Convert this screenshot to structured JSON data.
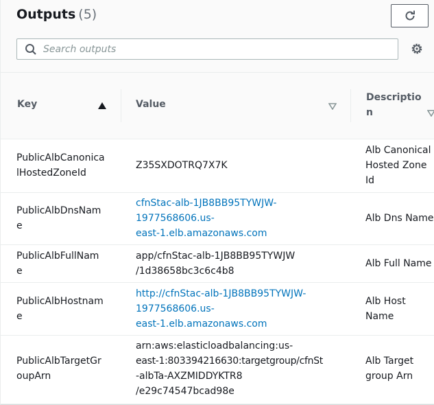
{
  "header": {
    "title": "Outputs",
    "count": "(5)",
    "refresh_icon": "refresh-icon",
    "settings_icon": "gear-icon"
  },
  "search": {
    "placeholder": "Search outputs",
    "icon": "search-icon"
  },
  "table": {
    "columns": {
      "key": "Key",
      "value": "Value",
      "description_line1": "Descriptio",
      "description_line2": "n"
    },
    "sort": {
      "column": "Key",
      "direction": "ascending"
    },
    "rows": [
      {
        "key": [
          "PublicAlbCanonica",
          "lHostedZoneId"
        ],
        "value": [
          "Z35SXDOTRQ7X7K"
        ],
        "value_is_link": false,
        "description": [
          "Alb Canonical",
          "Hosted Zone",
          "Id"
        ]
      },
      {
        "key": [
          "PublicAlbDnsNam",
          "e"
        ],
        "value": [
          "cfnStac-alb-1JB8BB95TYWJW-",
          "1977568606.us-",
          "east-1.elb.amazonaws.com"
        ],
        "value_is_link": true,
        "description": [
          "Alb Dns Name"
        ]
      },
      {
        "key": [
          "PublicAlbFullNam",
          "e"
        ],
        "value": [
          "app/cfnStac-alb-1JB8BB95TYWJW",
          "/1d38658bc3c6c4b8"
        ],
        "value_is_link": false,
        "description": [
          "Alb Full Name"
        ]
      },
      {
        "key": [
          "PublicAlbHostnam",
          "e"
        ],
        "value": [
          "http://cfnStac-alb-1JB8BB95TYWJW-",
          "1977568606.us-",
          "east-1.elb.amazonaws.com"
        ],
        "value_is_link": true,
        "description": [
          "Alb Host",
          "Name"
        ]
      },
      {
        "key": [
          "PublicAlbTargetGr",
          "oupArn"
        ],
        "value": [
          "arn:aws:elasticloadbalancing:us-",
          "east-1:803394216630:targetgroup/cfnSt",
          "-albTa-AXZMIDDYKTR8",
          "/e29c74547bcad98e"
        ],
        "value_is_link": false,
        "description": [
          "Alb Target",
          "group Arn"
        ]
      }
    ]
  },
  "colors": {
    "link": "#0073bb",
    "text": "#16191f",
    "muted": "#687078",
    "header_bg": "#fafafa"
  }
}
